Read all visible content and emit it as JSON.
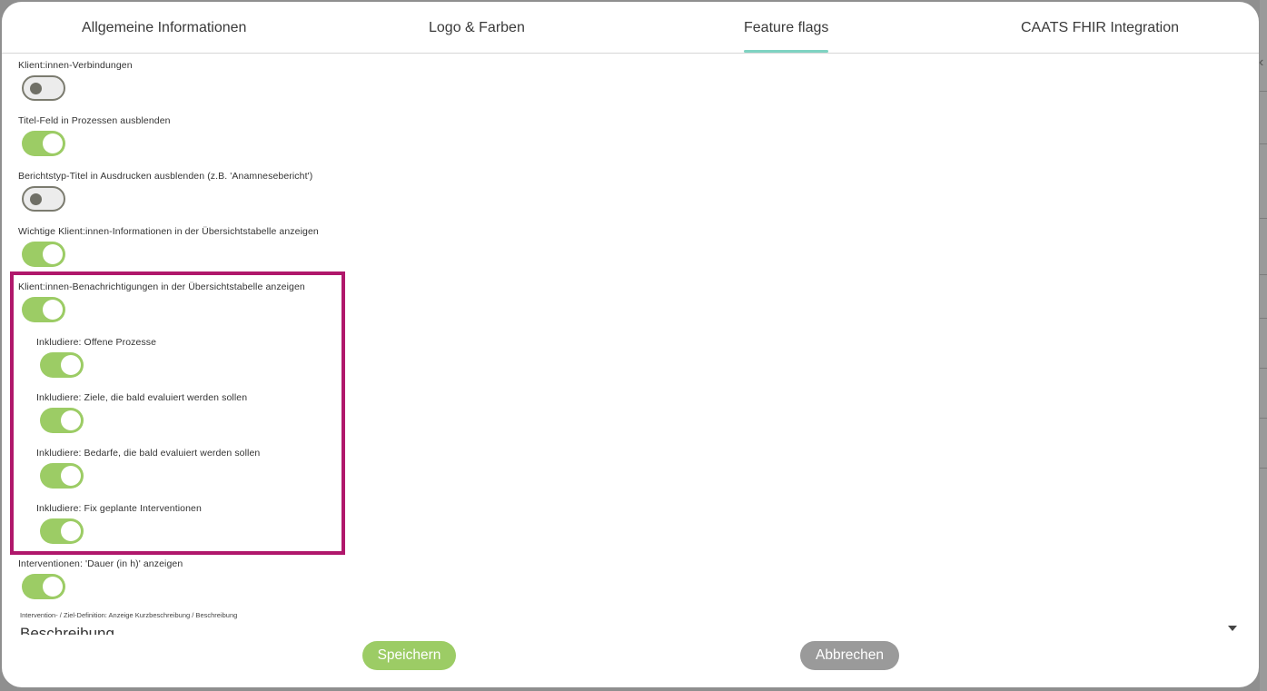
{
  "tabs": [
    {
      "label": "Allgemeine Informationen",
      "active": false
    },
    {
      "label": "Logo & Farben",
      "active": false
    },
    {
      "label": "Feature flags",
      "active": true
    },
    {
      "label": "CAATS FHIR Integration",
      "active": false
    }
  ],
  "flags": [
    {
      "label": "Klient:innen-Verbindungen",
      "enabled": false
    },
    {
      "label": "Titel-Feld in Prozessen ausblenden",
      "enabled": true
    },
    {
      "label": "Berichtstyp-Titel in Ausdrucken ausblenden (z.B. 'Anamnesebericht')",
      "enabled": false
    },
    {
      "label": "Wichtige Klient:innen-Informationen in der Übersichtstabelle anzeigen",
      "enabled": true
    },
    {
      "label": "Klient:innen-Benachrichtigungen in der Übersichtstabelle anzeigen",
      "enabled": true
    },
    {
      "label": "Inkludiere: Offene Prozesse",
      "enabled": true
    },
    {
      "label": "Inkludiere: Ziele, die bald evaluiert werden sollen",
      "enabled": true
    },
    {
      "label": "Inkludiere: Bedarfe, die bald evaluiert werden sollen",
      "enabled": true
    },
    {
      "label": "Inkludiere: Fix geplante Interventionen",
      "enabled": true
    },
    {
      "label": "Interventionen: 'Dauer (in h)' anzeigen",
      "enabled": true
    }
  ],
  "description_select": {
    "label": "Intervention- / Ziel-Definition: Anzeige Kurzbeschreibung / Beschreibung",
    "value": "Beschreibung"
  },
  "buttons": {
    "save": "Speichern",
    "cancel": "Abbrechen"
  },
  "colors": {
    "toggle_on": "#9ccc65",
    "tab_indicator": "#7fd3c2",
    "highlight_border": "#b0176b",
    "cancel_button": "#9a9a9a"
  }
}
